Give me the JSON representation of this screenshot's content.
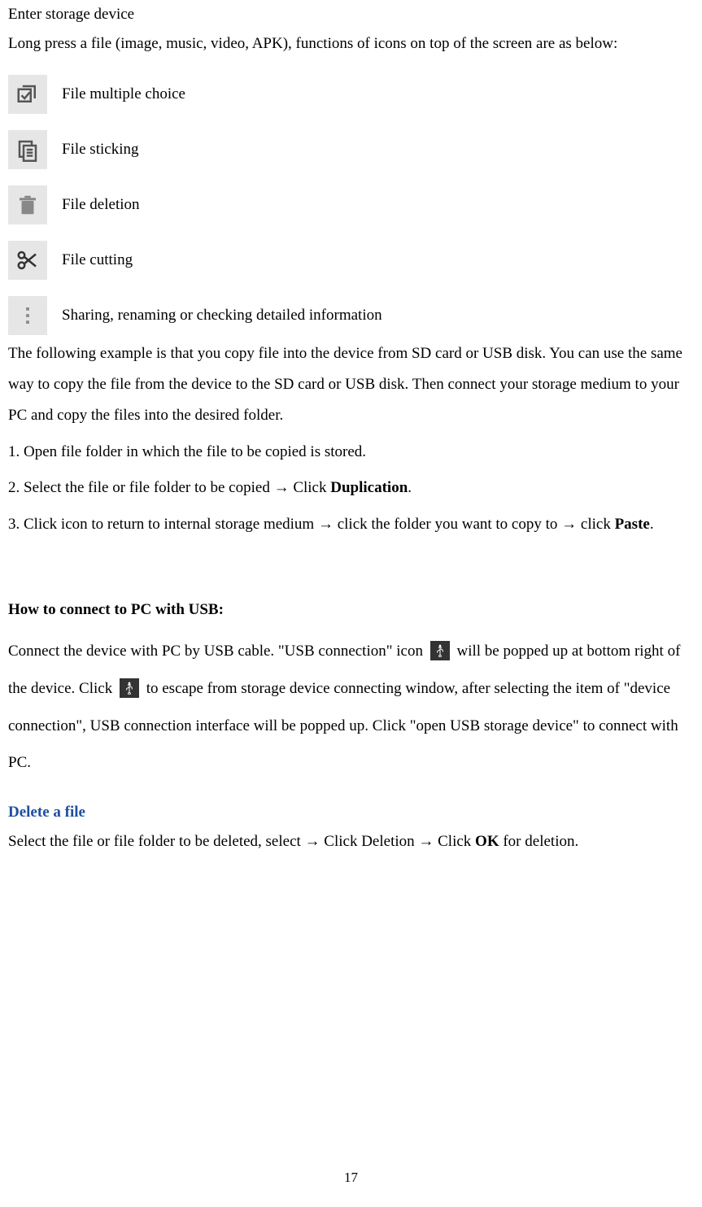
{
  "intro": {
    "line1": "Enter storage device",
    "line2": "Long press a file (image, music, video, APK), functions of icons on top of the screen are as below:"
  },
  "icons": {
    "multi": "File multiple choice",
    "sticking": "File sticking",
    "deletion": "File deletion",
    "cutting": "File cutting",
    "more": "Sharing, renaming or checking detailed information"
  },
  "copy_para": "The following example is that you copy file into the device from SD card or USB disk. You can use the same way to copy the file from the device to the SD card or USB disk. Then connect your storage medium to your PC and copy the files into the desired folder.",
  "steps": {
    "s1": "1.    Open file folder in which the file to be copied is stored.",
    "s2a": "2.     Select the file or file folder to be copied → Click ",
    "s2b": "Duplication",
    "s2c": ".",
    "s3a": "3.     Click icon to return to internal storage medium → click the folder you want to copy to → click ",
    "s3b": "Paste",
    "s3c": "."
  },
  "usb": {
    "heading": "How to connect to PC with USB:",
    "p1a": "Connect the device with PC by USB cable. \"USB connection\" icon ",
    "p1b": " will be popped up at bottom right of the device. Click ",
    "p1c": " to escape from storage device connecting window, after selecting the item of \"device connection\", USB connection interface will be popped up. Click \"open USB storage device\" to connect with PC."
  },
  "delete": {
    "heading": "Delete a file",
    "texta": "Select the file or file folder to be deleted, select → Click Deletion → Click ",
    "textb": "OK",
    "textc": " for deletion."
  },
  "page": "17"
}
